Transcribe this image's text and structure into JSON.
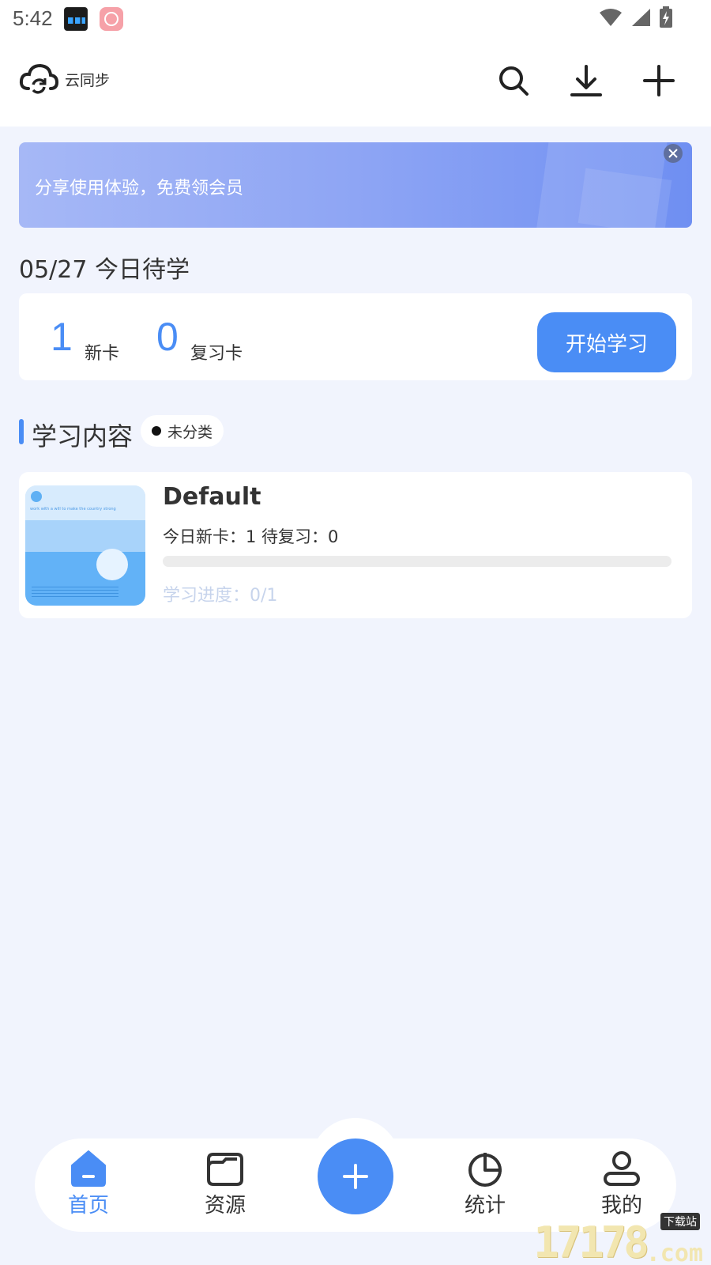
{
  "status_bar": {
    "time": "5:42"
  },
  "header": {
    "sync_label": "云同步",
    "icons": [
      "cloud-sync-icon",
      "search-icon",
      "download-icon",
      "plus-icon"
    ]
  },
  "banner": {
    "text": "分享使用体验，免费领会员"
  },
  "today": {
    "title": "05/27 今日待学",
    "new_count": "1",
    "new_label": "新卡",
    "review_count": "0",
    "review_label": "复习卡",
    "start_button": "开始学习"
  },
  "study_section": {
    "title": "学习内容",
    "category": "未分类"
  },
  "deck": {
    "name": "Default",
    "stats": "今日新卡：1 待复习：0",
    "progress_text": "学习进度：0/1",
    "progress": 0,
    "thumb_caption": "work with a will to make the country strong"
  },
  "bottom_nav": {
    "home": "首页",
    "resources": "资源",
    "stats": "统计",
    "mine": "我的"
  },
  "watermark": {
    "number": "17178",
    "suffix": ".com",
    "tag": "下载站"
  },
  "colors": {
    "accent": "#4a8df5",
    "background": "#f1f4fd"
  }
}
